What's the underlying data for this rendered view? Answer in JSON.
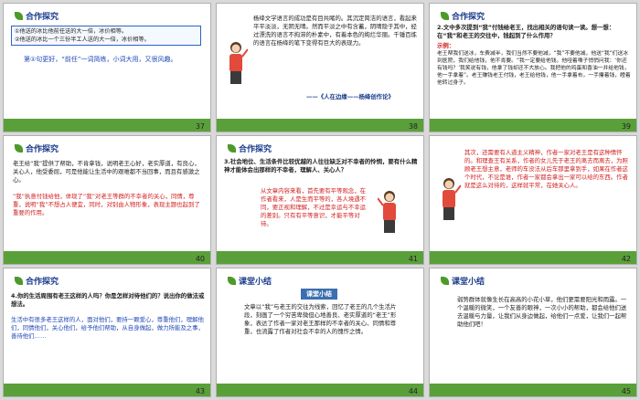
{
  "slides": [
    {
      "number": "37",
      "tag": "合作探究",
      "q1": "①他送的冰比他前任送的大一倍，冰价相等。",
      "q2": "②他送的冰比一个三份半工人送的大一倍，冰价相等。",
      "answer": "第①句更好，“前任”一词简练，小词大用，又很风趣。"
    },
    {
      "number": "38",
      "body": "杨绛文学语言的成功是有目共睹的。其沉定简洁的语言，看起来平平淡淡，无阴无晴。然而平淡之中有含蓄，阴晴隐于其中，经过漂洗的语言不拘滞的朴素中，有着本色的绚烂华丽。千锤百炼的语言在杨绛的笔下变得有巨大的表现力。",
      "source": "——《人在边缘——杨绛创作论》"
    },
    {
      "number": "39",
      "tag": "合作探究",
      "question": "2.文中多次提到“我”付钱给老王，找出相关的语句读一读。想一想：在“我”和老王的交往中，钱起到了什么作用？",
      "example_label": "示例：",
      "body": "老王帮我们送冰，车费减半，我们当然不要他减，“我”不要他减，他送“我”们送冰到医院，我们给他钱，他不肯要。“我一定要给他钱，他哑着嗓子悄悄问我：‘你还有钱吗？’我笑说有钱，他拿了钱却还不大放心。我把他的鸡蛋和香油一并给他钱，他一手拿着”。老王赚钱老王付钱，老王给他钱，他一手拿着布，一手攥着钱，瞪着他转过身子。"
    },
    {
      "number": "40",
      "tag": "合作探究",
      "body": "老王给“我”提供了帮助，不肯拿钱，说明老王心好，老实厚道，有良心，关心人，他受委屈，可是他能让生活中的艰难都不当回事，而且有感激之心。",
      "highlight": "“我”执意付钱给他，体现了“我”对老王等群的不幸者的关心，同情，尊重，说明“我”不想占人便宜，同时，对别由人物形象，表现主题也起到了重要的作用。"
    },
    {
      "number": "41",
      "tag": "合作探究",
      "question": "3.社会地位、生活条件比较优越的人往往缺乏对不幸者的怜悯，要有什么精神才能体会出那样的不幸者，理解人、关心人？",
      "answer": "从文章内容来看，首先要有平等观念，在作者看来，人是生而平等的，各人境遇不同，要正视和理解，不过是幸运与不幸运的差别。只有有平等意识，才能平等对待。"
    },
    {
      "number": "42",
      "body": "其次，还需要有人道主义精神，作者一家对老王是有这种情怀的。和理查王有关系，作者的女儿先于老王的离去而离去，为照顾老王想主意，老师的车没法从后车那里拿到手，如果在作者这个时代，不论是谁，作者一家都会拿出一家可以给的东西。作者就是这么对待的，这样就平常，在她关心人。"
    },
    {
      "number": "43",
      "tag": "合作探究",
      "question": "4.你的生活周围有老王这样的人吗？你是怎样对待他们的？说出你的做法或想法。",
      "answer": "生活中有很多老王这样的人，面对他们，要持一颗爱心，尊重他们，理解他们，同情他们，关心他们，给予他们帮助，从自身做起，做力所能及之事，善待他们……"
    },
    {
      "number": "44",
      "tag": "课堂小结",
      "badge": "课堂小结",
      "body": "文章以“我”与老王的交往为线索，回忆了老王的几个生活片段，刻画了一个穷苦卑微但心地善良、老实厚道的“老王”形象，表达了作者一家对老王那样的不幸者的关心、同情和尊重，也流露了作者对社会不幸的人的愧怍之情。"
    },
    {
      "number": "45",
      "tag": "课堂小结",
      "body": "弱势群体就像生长在高高的小花小草，他们更需要阳光和雨露。一个温暖的微笑，一个友善的眼神，一次小小的帮助，都会给他们送去温暖与力量，让我们从身边做起，给他们一点爱，让我们一起帮助他们吧！"
    }
  ],
  "colors": {
    "accent_green": "#5aa03a",
    "title_blue": "#1a3c8c",
    "highlight_red": "#d02020"
  }
}
